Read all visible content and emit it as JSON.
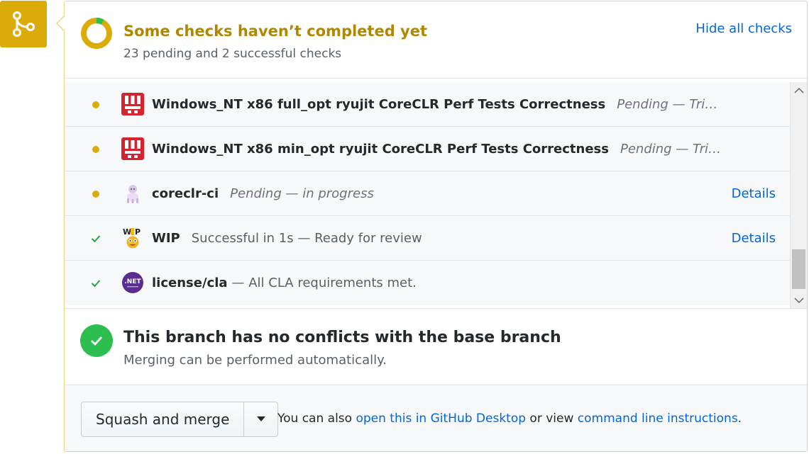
{
  "header": {
    "title": "Some checks haven’t completed yet",
    "subtitle": "23 pending and 2 successful checks",
    "hide_label": "Hide all checks",
    "progress_successful_fraction": 0.08
  },
  "checks": [
    {
      "status": "pending",
      "avatar": "jenkins-icon",
      "context": "Windows_NT x86 full_opt ryujit CoreCLR Perf Tests Correctness",
      "description": "Pending — Tri…",
      "details": ""
    },
    {
      "status": "pending",
      "avatar": "jenkins-icon",
      "context": "Windows_NT x86 min_opt ryujit CoreCLR Perf Tests Correctness",
      "description": "Pending — Tri…",
      "details": ""
    },
    {
      "status": "pending",
      "avatar": "azure-pipelines-icon",
      "context": "coreclr-ci",
      "description": "Pending — in progress",
      "details": "Details"
    },
    {
      "status": "success",
      "avatar": "wip-bot-icon",
      "context": "WIP",
      "description": "Successful in 1s — Ready for review",
      "details": "Details"
    },
    {
      "status": "success",
      "avatar": "dotnet-foundation-icon",
      "context": "license/cla",
      "description": "— All CLA requirements met.",
      "details": ""
    }
  ],
  "merge_status": {
    "title": "This branch has no conflicts with the base branch",
    "subtitle": "Merging can be performed automatically."
  },
  "merge": {
    "button_label": "Squash and merge",
    "note_prefix": "You can also ",
    "desktop_link": "open this in GitHub Desktop",
    "note_middle": " or view ",
    "cli_link": "command line instructions",
    "note_suffix": "."
  },
  "colors": {
    "pending": "#dbab09",
    "success": "#28a745",
    "link": "#0366d6"
  }
}
